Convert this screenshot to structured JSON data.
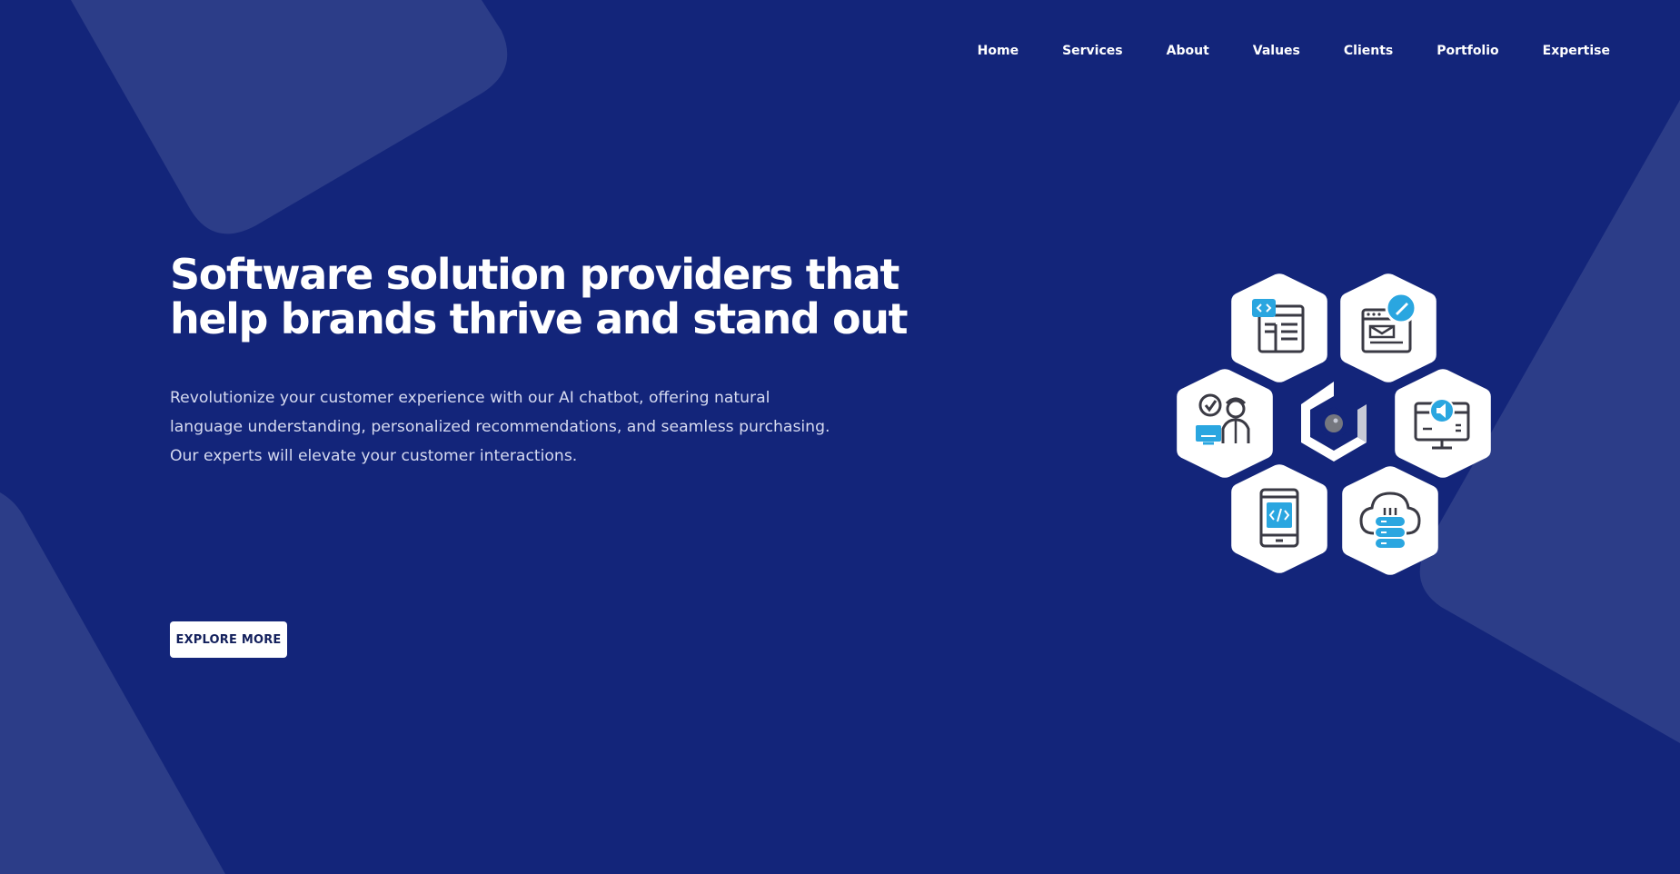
{
  "nav": {
    "items": [
      {
        "label": "Home"
      },
      {
        "label": "Services"
      },
      {
        "label": "About"
      },
      {
        "label": "Values"
      },
      {
        "label": "Clients"
      },
      {
        "label": "Portfolio"
      },
      {
        "label": "Expertise"
      }
    ]
  },
  "hero": {
    "title_line1": "Software solution providers that",
    "title_line2": "help brands thrive and stand out",
    "description": "Revolutionize your customer experience with our AI chatbot, offering natural language understanding, personalized recommendations, and seamless purchasing. Our experts will elevate your customer interactions.",
    "cta_label": "EXPLORE MORE"
  },
  "colors": {
    "background": "#13257a",
    "shape": "#2c3d88",
    "accent": "#2aa6e0",
    "icon_stroke": "#3a3a44",
    "text": "#ffffff"
  },
  "icons": [
    "web-development-icon",
    "web-design-icon",
    "customer-support-icon",
    "brand-logo-icon",
    "digital-marketing-icon",
    "mobile-app-icon",
    "cloud-services-icon"
  ]
}
